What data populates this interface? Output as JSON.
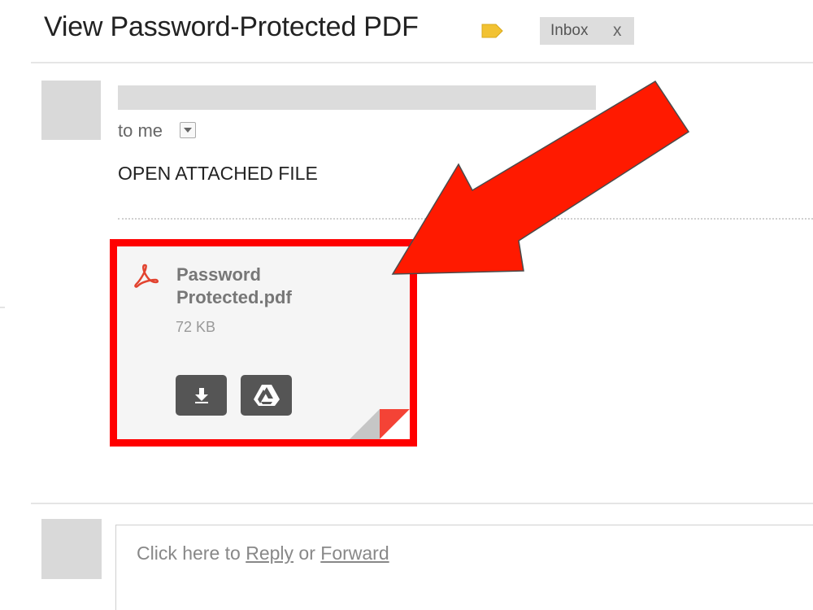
{
  "email": {
    "subject": "View Password-Protected PDF",
    "label_icon": "label-tag-icon",
    "label_color": "#f2c232",
    "label_chip": {
      "text": "Inbox",
      "remove": "x"
    }
  },
  "message": {
    "recipient": "to me",
    "body": "OPEN ATTACHED FILE"
  },
  "attachment": {
    "file_name": "Password Protected.pdf",
    "file_size": "72 KB",
    "type_icon": "pdf-icon",
    "buttons": [
      {
        "icon": "download-icon"
      },
      {
        "icon": "google-drive-icon"
      }
    ],
    "highlight_color": "#ff0000",
    "accent_color": "#f44336"
  },
  "annotation": {
    "arrow_color": "#ff1a00",
    "arrow_icon": "big-arrow-icon"
  },
  "reply": {
    "prompt_prefix": "Click here to ",
    "reply_link": "Reply",
    "separator": " or ",
    "forward_link": "Forward"
  }
}
